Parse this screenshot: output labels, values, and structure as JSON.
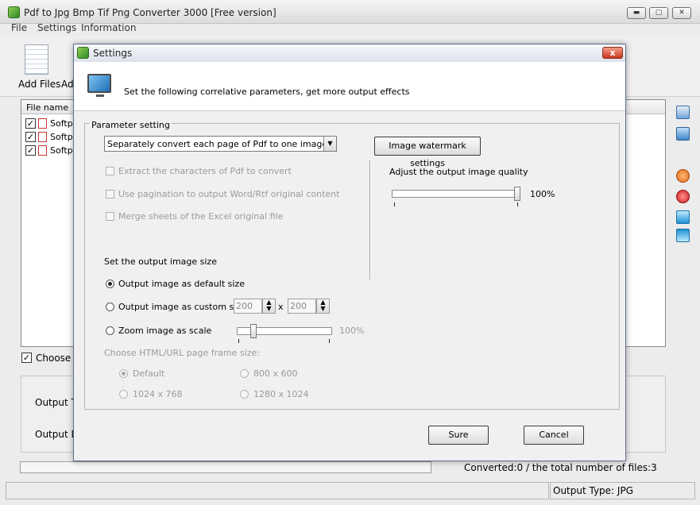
{
  "main": {
    "title": "Pdf to Jpg Bmp Tif Png Converter 3000 [Free version]",
    "window_buttons": {
      "minimize": "▬",
      "maximize": "▢",
      "close": "✕"
    },
    "menu": [
      "File",
      "Settings",
      "Information"
    ],
    "toolbar": {
      "add_files": "Add Files",
      "add_folder": "Ad"
    },
    "file_list": {
      "column_file_name": "File name",
      "items": [
        {
          "name": "Softpe",
          "checked": true
        },
        {
          "name": "Softpe",
          "checked": true
        },
        {
          "name": "Softpe",
          "checked": true
        }
      ]
    },
    "choose_label": "Choose a",
    "output_type_label": "Output Ty",
    "output_dir_label": "Output Di",
    "converted_text": "Converted:0  /  the total number of files:3",
    "status_output_type": "Output Type: JPG"
  },
  "dialog": {
    "title": "Settings",
    "close_label": "x",
    "description": "Set the following correlative parameters, get more output effects",
    "param_group_label": "Parameter setting",
    "mode_select": "Separately convert each page of Pdf to one image",
    "watermark_button": "Image watermark settings",
    "quality_label": "Adjust the output image quality",
    "quality_value": "100%",
    "quality_level": 1.0,
    "checkboxes": [
      "Extract the characters of Pdf to convert",
      "Use pagination to output Word/Rtf original content",
      "Merge sheets of the Excel original file"
    ],
    "size_heading": "Set the output image size",
    "size_default": "Output image as default size",
    "size_custom": "Output image as custom size",
    "custom_width": "200",
    "custom_height": "200",
    "custom_x": "x",
    "zoom_label": "Zoom image as scale",
    "zoom_value": "100%",
    "frame_heading": "Choose HTML/URL page frame size:",
    "frame_options": [
      "Default",
      "800 x 600",
      "1024 x 768",
      "1280 x 1024"
    ],
    "sure_button": "Sure",
    "cancel_button": "Cancel"
  }
}
